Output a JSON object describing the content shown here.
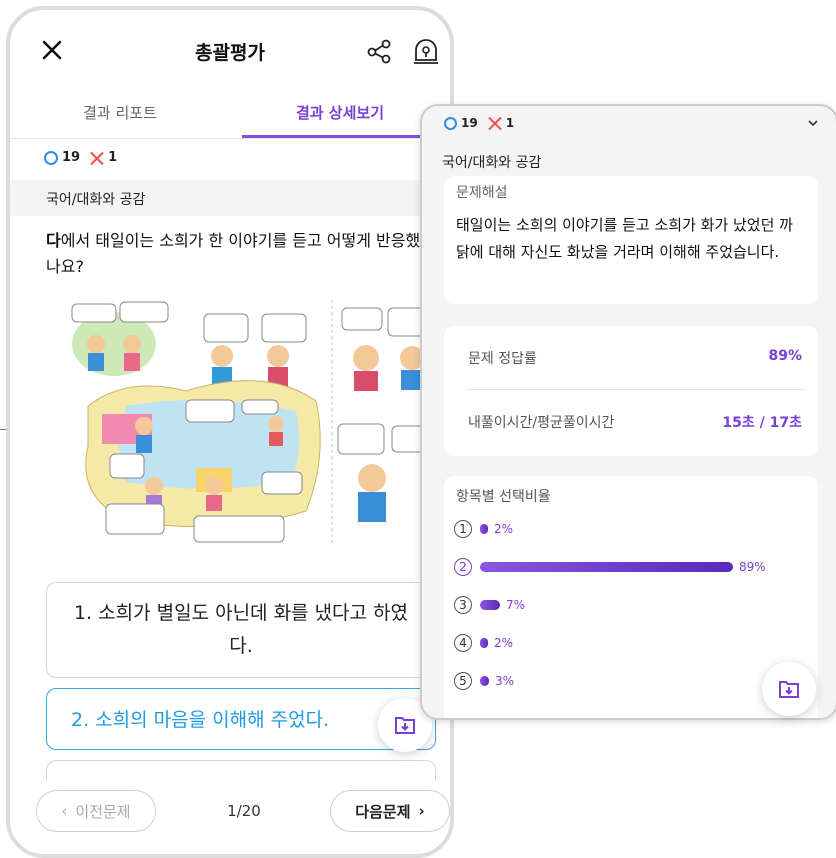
{
  "header": {
    "title": "총괄평가"
  },
  "tabs": [
    {
      "label": "결과 리포트"
    },
    {
      "label": "결과 상세보기"
    }
  ],
  "score": {
    "correct": "19",
    "wrong": "1"
  },
  "category": "국어/대화와 공감",
  "question": {
    "highlight": "다",
    "text": "에서 태일이는 소희가 한 이야기를 듣고 어떻게 반응했나요?"
  },
  "options": [
    {
      "label": "1. 소희가 별일도 아닌데 화를 냈다고 하였다."
    },
    {
      "label": "2. 소희의 마음을 이해해 주었다."
    }
  ],
  "nav": {
    "prev": "이전문제",
    "next": "다음문제",
    "page": "1/20"
  },
  "detail": {
    "score": {
      "correct": "19",
      "wrong": "1"
    },
    "category": "국어/대화와 공감",
    "explanation_title": "문제해설",
    "explanation": "태일이는 소희의 이야기를 듣고 소희가 화가 났었던 까닭에 대해 자신도 화났을 거라며 이해해 주었습니다.",
    "stats": [
      {
        "label": "문제 정답률",
        "value": "89%"
      },
      {
        "label": "내풀이시간/평균풀이시간",
        "value": "15초 / 17초"
      }
    ],
    "distribution_title": "항목별 선택비율",
    "distribution": [
      {
        "n": "1",
        "pct_label": "2%",
        "pct": 2
      },
      {
        "n": "2",
        "pct_label": "89%",
        "pct": 89,
        "selected": true
      },
      {
        "n": "3",
        "pct_label": "7%",
        "pct": 7
      },
      {
        "n": "4",
        "pct_label": "2%",
        "pct": 2
      },
      {
        "n": "5",
        "pct_label": "3%",
        "pct": 3
      }
    ]
  },
  "colors": {
    "accent": "#7a3fd4",
    "correct": "#2b8ff0",
    "wrong": "#f0504d",
    "selected_option": "#1d9ae0"
  },
  "icons": {
    "close": "close-icon",
    "share": "share-icon",
    "lamp": "lightbulb-icon",
    "download": "download-folder-icon",
    "chevron": "chevron-down-icon"
  }
}
